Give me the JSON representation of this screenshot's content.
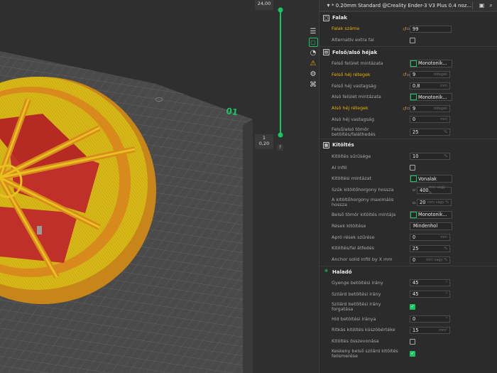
{
  "viewport": {
    "plate_label": "01",
    "layer_top": "24,00",
    "layer_bottom_index": "1",
    "layer_bottom_height": "0,20",
    "help": "?"
  },
  "preset": {
    "name": "* 0.20mm Standard @Creality Ender-3 V3 Plus 0.4 noz..."
  },
  "sidebar_icons": [
    "list-icon",
    "shell-icon",
    "speed-icon",
    "support-icon",
    "settings-icon",
    "multi-icon"
  ],
  "sections": {
    "walls": {
      "title": "Falak",
      "rows": {
        "wall_loops": {
          "label": "Falak száma",
          "value": "99"
        },
        "alt_extra_wall": {
          "label": "Alternatív extra fal"
        }
      }
    },
    "shells": {
      "title": "Felső/alsó héjak",
      "rows": {
        "top_pattern": {
          "label": "Felső felület mintázata",
          "value": "Monotonik..."
        },
        "top_layers": {
          "label": "Felső héj rétegek",
          "value": "9",
          "unit": "rétegek"
        },
        "top_thickness": {
          "label": "Felső héj vastagság",
          "value": "0.8",
          "unit": "mm"
        },
        "bottom_pattern": {
          "label": "Alsó felület mintázata",
          "value": "Monotonik..."
        },
        "bottom_layers": {
          "label": "Alsó héj rétegek",
          "value": "9",
          "unit": "rétegek"
        },
        "bottom_thickness": {
          "label": "Alsó héj vastagság",
          "value": "0",
          "unit": "mm"
        },
        "solid_overlap": {
          "label": "Felső/alsó tömör betöltés/faláthedés",
          "value": "25",
          "unit": "%"
        }
      }
    },
    "infill": {
      "title": "Kitöltés",
      "rows": {
        "density": {
          "label": "Kitöltés sűrűsége",
          "value": "10",
          "unit": "%"
        },
        "ai_infill": {
          "label": "AI infill"
        },
        "pattern": {
          "label": "Kitöltési mintázat",
          "value": "Vonalak"
        },
        "anchor_len": {
          "label": "Szűk kitöltőhorgony hossza",
          "value": "400",
          "unit": "mm vagy %"
        },
        "anchor_max": {
          "label": "A kitöltőhorgony maximális hossza",
          "value": "20",
          "unit": "mm vagy %"
        },
        "internal_solid": {
          "label": "Belső tömör kitöltés mintája",
          "value": "Monotonik..."
        },
        "gap_fill": {
          "label": "Rések kitöltése",
          "value": "Mindenhol"
        },
        "gap_filter": {
          "label": "Apró rések szűrése",
          "value": "0",
          "unit": "mm"
        },
        "infill_wall_overlap": {
          "label": "Kitöltés/fal átfedés",
          "value": "25",
          "unit": "%"
        },
        "anchor_solid": {
          "label": "Anchor solid infill by X mm",
          "value": "0",
          "unit": "mm vagy %"
        }
      }
    },
    "advanced": {
      "title": "Haladó",
      "rows": {
        "sparse_dir": {
          "label": "Gyenge betöltési irány",
          "value": "45",
          "unit": "°"
        },
        "solid_dir": {
          "label": "Szilárd betöltési irány",
          "value": "45",
          "unit": "°"
        },
        "solid_rotate": {
          "label": "Szilárd betöltési irány forgatása"
        },
        "bridge_dir": {
          "label": "Híd betöltési iránya",
          "value": "0",
          "unit": "°"
        },
        "sparse_threshold": {
          "label": "Ritkás kitöltés küszöbértéke",
          "value": "15",
          "unit": "mm²"
        },
        "combine": {
          "label": "Kitöltés összevonása"
        },
        "narrow_internal": {
          "label": "Keskeny belső szilárd kitöltés felismerése"
        }
      }
    }
  },
  "colors": {
    "accent": "#19c463",
    "highlight": "#e8b200",
    "reset": "#e08a2a",
    "model_yellow": "#e0c218",
    "model_red": "#c0302a",
    "model_orange": "#d87818"
  }
}
